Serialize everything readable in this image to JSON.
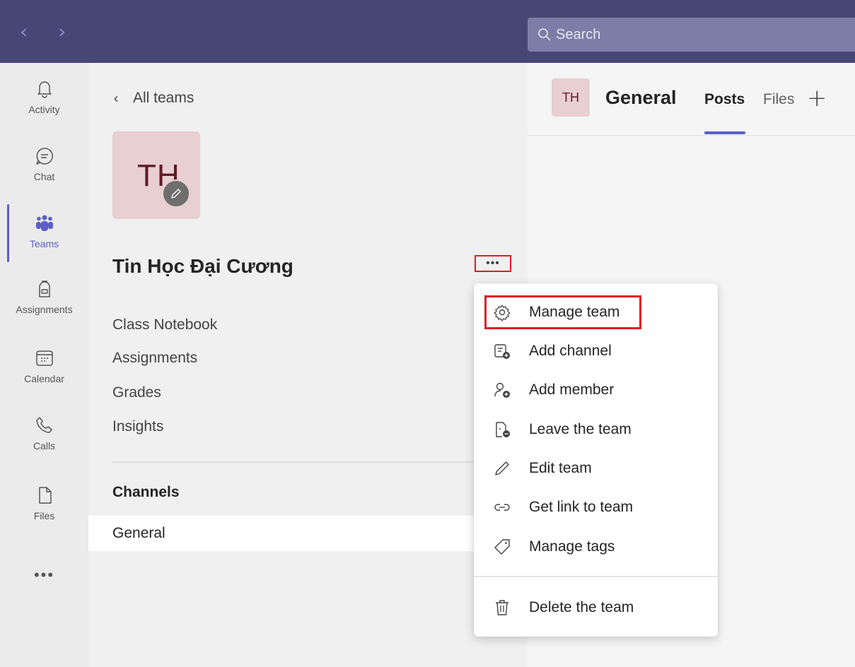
{
  "search": {
    "placeholder": "Search"
  },
  "rail": {
    "items": [
      {
        "label": "Activity",
        "icon": "bell-icon"
      },
      {
        "label": "Chat",
        "icon": "chat-icon"
      },
      {
        "label": "Teams",
        "icon": "teams-icon",
        "active": true
      },
      {
        "label": "Assignments",
        "icon": "backpack-icon"
      },
      {
        "label": "Calendar",
        "icon": "calendar-icon"
      },
      {
        "label": "Calls",
        "icon": "phone-icon"
      },
      {
        "label": "Files",
        "icon": "file-icon"
      }
    ],
    "more": "•••"
  },
  "panel": {
    "back_label": "All teams",
    "team_initials": "TH",
    "team_name": "Tin Học Đại Cương",
    "more_label": "•••",
    "tabs": [
      "Class Notebook",
      "Assignments",
      "Grades",
      "Insights"
    ],
    "channels_heading": "Channels",
    "channels": [
      "General"
    ]
  },
  "main": {
    "channel_initials": "TH",
    "channel_title": "General",
    "tabs": [
      {
        "label": "Posts",
        "active": true
      },
      {
        "label": "Files",
        "active": false
      }
    ],
    "add_tab": "+"
  },
  "menu": {
    "items": [
      {
        "label": "Manage team",
        "icon": "gear-icon"
      },
      {
        "label": "Add channel",
        "icon": "add-channel-icon"
      },
      {
        "label": "Add member",
        "icon": "add-member-icon"
      },
      {
        "label": "Leave the team",
        "icon": "leave-team-icon"
      },
      {
        "label": "Edit team",
        "icon": "pencil-icon"
      },
      {
        "label": "Get link to team",
        "icon": "link-icon"
      },
      {
        "label": "Manage tags",
        "icon": "tag-icon"
      },
      {
        "label": "Delete the team",
        "icon": "trash-icon"
      }
    ]
  },
  "colors": {
    "topbar": "#464775",
    "accent": "#5b5fc7",
    "highlight": "#e21b23",
    "avatar_bg": "#e8cfd2"
  }
}
